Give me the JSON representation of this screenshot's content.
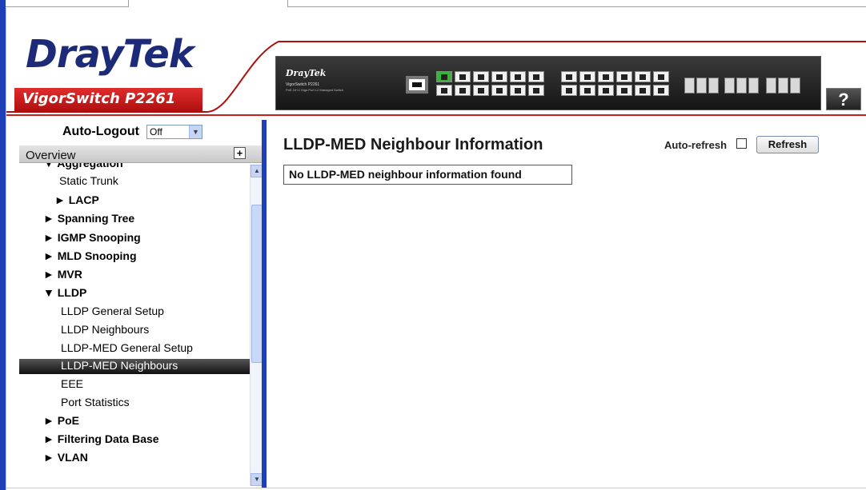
{
  "header": {
    "logo_dray": "Dray",
    "logo_tek": "Tek",
    "model": "VigorSwitch P2261",
    "device_brand": "DrayTek",
    "device_model": "VigorSwitch P2261",
    "device_desc": "PoE 24+2 Giga Port L2 Managed Switch",
    "help_symbol": "?"
  },
  "sidebar": {
    "auto_logout_label": "Auto-Logout",
    "auto_logout_value": "Off",
    "overview_label": "Overview",
    "items": [
      {
        "label": "▼ Aggregation",
        "level": 0
      },
      {
        "label": "Static Trunk",
        "level": 2
      },
      {
        "label": "► LACP",
        "level": 1
      },
      {
        "label": "► Spanning Tree",
        "level": 0
      },
      {
        "label": "► IGMP Snooping",
        "level": 0
      },
      {
        "label": "► MLD Snooping",
        "level": 0
      },
      {
        "label": "► MVR",
        "level": 0
      },
      {
        "label": "▼ LLDP",
        "level": 0
      },
      {
        "label": "LLDP General Setup",
        "level": 2
      },
      {
        "label": "LLDP Neighbours",
        "level": 2
      },
      {
        "label": "LLDP-MED General Setup",
        "level": 2
      },
      {
        "label": "LLDP-MED Neighbours",
        "level": 2,
        "active": true
      },
      {
        "label": "EEE",
        "level": 2
      },
      {
        "label": "Port Statistics",
        "level": 2
      },
      {
        "label": "► PoE",
        "level": 0
      },
      {
        "label": "► Filtering Data Base",
        "level": 0
      },
      {
        "label": "► VLAN",
        "level": 0
      }
    ]
  },
  "main": {
    "title": "LLDP-MED Neighbour Information",
    "auto_refresh_label": "Auto-refresh",
    "auto_refresh_checked": false,
    "refresh_button": "Refresh",
    "notice": "No LLDP-MED neighbour information found"
  },
  "colors": {
    "brand_blue": "#1c2a78",
    "brand_red": "#c81e1e",
    "frame_blue": "#1f3fb8",
    "active_bg": "#222222"
  }
}
